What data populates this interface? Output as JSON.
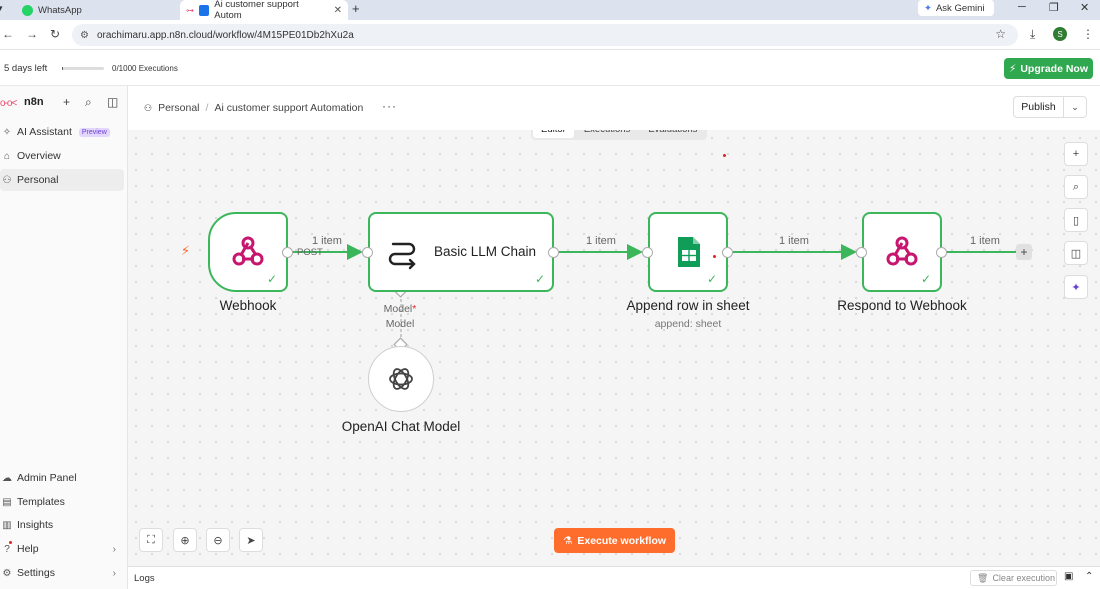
{
  "browser": {
    "tabs": [
      {
        "title": "WhatsApp",
        "active": false
      },
      {
        "title": "Ai customer support Autom",
        "active": true
      }
    ],
    "new_tab": "+",
    "gemini_label": "Ask Gemini",
    "url": "orachimaru.app.n8n.cloud/workflow/4M15PE01Db2hXu2a",
    "profile_initial": "S"
  },
  "trial": {
    "days_left": "5 days left",
    "progress": 0.03,
    "executions": "0/1000 Executions",
    "upgrade_label": "Upgrade Now"
  },
  "sidebar": {
    "brand": "n8n",
    "top_items": [
      {
        "label": "AI Assistant",
        "badge": "Preview"
      },
      {
        "label": "Overview"
      },
      {
        "label": "Personal",
        "active": true
      }
    ],
    "bottom_items": [
      {
        "label": "Admin Panel"
      },
      {
        "label": "Templates"
      },
      {
        "label": "Insights"
      },
      {
        "label": "Help"
      },
      {
        "label": "Settings"
      }
    ]
  },
  "header": {
    "project": "Personal",
    "workflow_name": "Ai customer support Automation",
    "publish_label": "Publish"
  },
  "canvas_tabs": [
    "Editor",
    "Executions",
    "Evaluations"
  ],
  "nodes": {
    "webhook": {
      "label": "Webhook",
      "method": "POST"
    },
    "llm_chain": {
      "label": "Basic LLM Chain",
      "model_port": "Model",
      "model_port_required": "*",
      "model_sub": "Model"
    },
    "sheet": {
      "label": "Append row in sheet",
      "sub": "append: sheet"
    },
    "respond": {
      "label": "Respond to Webhook"
    },
    "openai": {
      "label": "OpenAI Chat Model"
    }
  },
  "edges": {
    "e1": "1 item",
    "e2": "1 item",
    "e3": "1 item",
    "e4": "1 item"
  },
  "colors": {
    "success": "#3cb65a",
    "webhook_pink": "#c7166f",
    "trigger": "#ff6d2d",
    "upgrade": "#2fa84f",
    "sheets_green": "#0f9d58"
  },
  "execute_label": "Execute workflow",
  "logs": {
    "label": "Logs",
    "clear_label": "Clear execution"
  }
}
